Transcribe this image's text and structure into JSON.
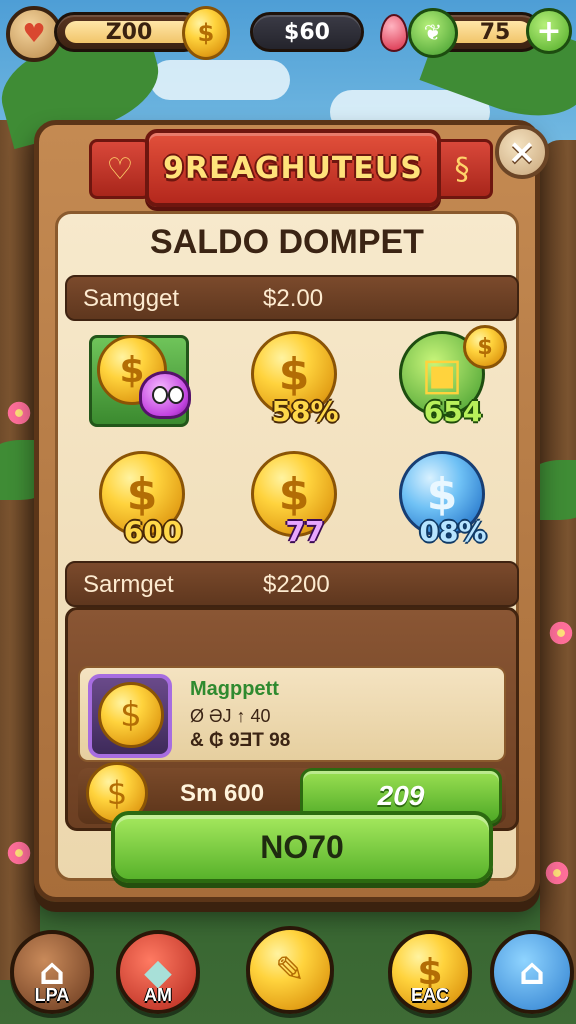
{
  "topbar": {
    "resource_left": "Z00",
    "resource_mid": "$60",
    "resource_right": "75",
    "add_symbol": "+"
  },
  "panel": {
    "banner_title": "9REAGHUTEUS",
    "heading": "SALDO DOMPET",
    "close_symbol": "×",
    "balance_row_1": {
      "label": "Samgget",
      "amount": "$2.00"
    },
    "coin_grid": [
      {
        "value": ""
      },
      {
        "value": "58%"
      },
      {
        "value": "654"
      },
      {
        "value": "600"
      },
      {
        "value": "77"
      },
      {
        "value": "08%"
      }
    ],
    "balance_row_2": {
      "label": "Sarmget",
      "amount": "$2200"
    },
    "item": {
      "name": "Magppett",
      "line1": "Ø ƏJ  ↑  40",
      "line2": "& ₲  9ƎT  98",
      "cost": "Sm 600",
      "buy_label": "209"
    },
    "main_button_label": "NO70"
  },
  "bottom_nav": {
    "items": [
      {
        "label": "LPA",
        "icon": "house-icon"
      },
      {
        "label": "AM",
        "icon": "map-icon"
      },
      {
        "label": "",
        "icon": "feather-coin-icon"
      },
      {
        "label": "EAC",
        "icon": "dollar-coin-icon"
      },
      {
        "label": "",
        "icon": "home-icon"
      }
    ]
  },
  "colors": {
    "panel_wood": "#a76d3a",
    "banner_red": "#b4281d",
    "button_green": "#58b22b",
    "coin_gold": "#ffd33d"
  }
}
